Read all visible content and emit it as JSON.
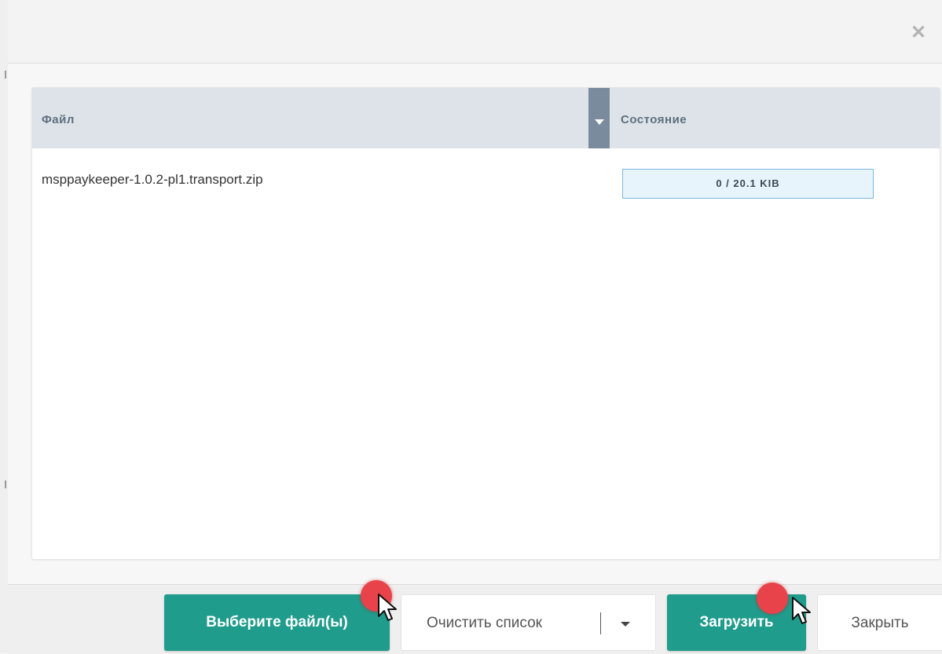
{
  "dialog": {
    "close_glyph": "✕"
  },
  "grid": {
    "columns": {
      "file": "Файл",
      "state": "Состояние"
    },
    "rows": [
      {
        "file": "msppaykeeper-1.0.2-pl1.transport.zip",
        "progress_text": "0 / 20.1 KIB",
        "progress_fraction": 0
      }
    ]
  },
  "footer": {
    "select_files_label": "Выберите файл(ы)",
    "clear_list_label": "Очистить список",
    "upload_label": "Загрузить",
    "close_label": "Закрыть"
  },
  "colors": {
    "primary_button": "#1f9c8c",
    "grid_header": "#dde3e9",
    "column_trigger": "#7b8b9e",
    "progress_border": "#7ab8dc",
    "click_marker": "#e8424a"
  },
  "icons": {
    "close": "close-icon",
    "column_menu": "column-menu-trigger-icon",
    "split_caret": "chevron-down-icon",
    "cursor": "mouse-pointer-icon"
  }
}
